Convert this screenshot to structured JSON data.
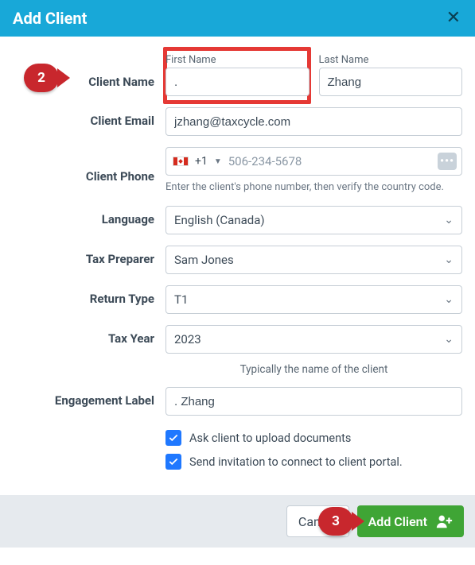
{
  "header": {
    "title": "Add Client"
  },
  "callouts": {
    "step2": "2",
    "step3": "3"
  },
  "labels": {
    "clientName": "Client Name",
    "firstName": "First Name",
    "lastName": "Last Name",
    "clientEmail": "Client Email",
    "clientPhone": "Client Phone",
    "language": "Language",
    "taxPreparer": "Tax Preparer",
    "returnType": "Return Type",
    "taxYear": "Tax Year",
    "engagementLabel": "Engagement Label"
  },
  "values": {
    "firstName": ".",
    "lastName": "Zhang",
    "email": "jzhang@taxcycle.com",
    "dialCode": "+1",
    "phone": "506-234-5678",
    "language": "English (Canada)",
    "taxPreparer": "Sam Jones",
    "returnType": "T1",
    "taxYear": "2023",
    "engagementLabel": ". Zhang"
  },
  "hints": {
    "phone": "Enter the client's phone number, then verify the country code.",
    "engagement": "Typically the name of the client"
  },
  "checks": {
    "uploadDocs": "Ask client to upload documents",
    "sendInvite": "Send invitation to connect to client portal."
  },
  "footer": {
    "cancel": "Cancel",
    "addClient": "Add Client"
  }
}
